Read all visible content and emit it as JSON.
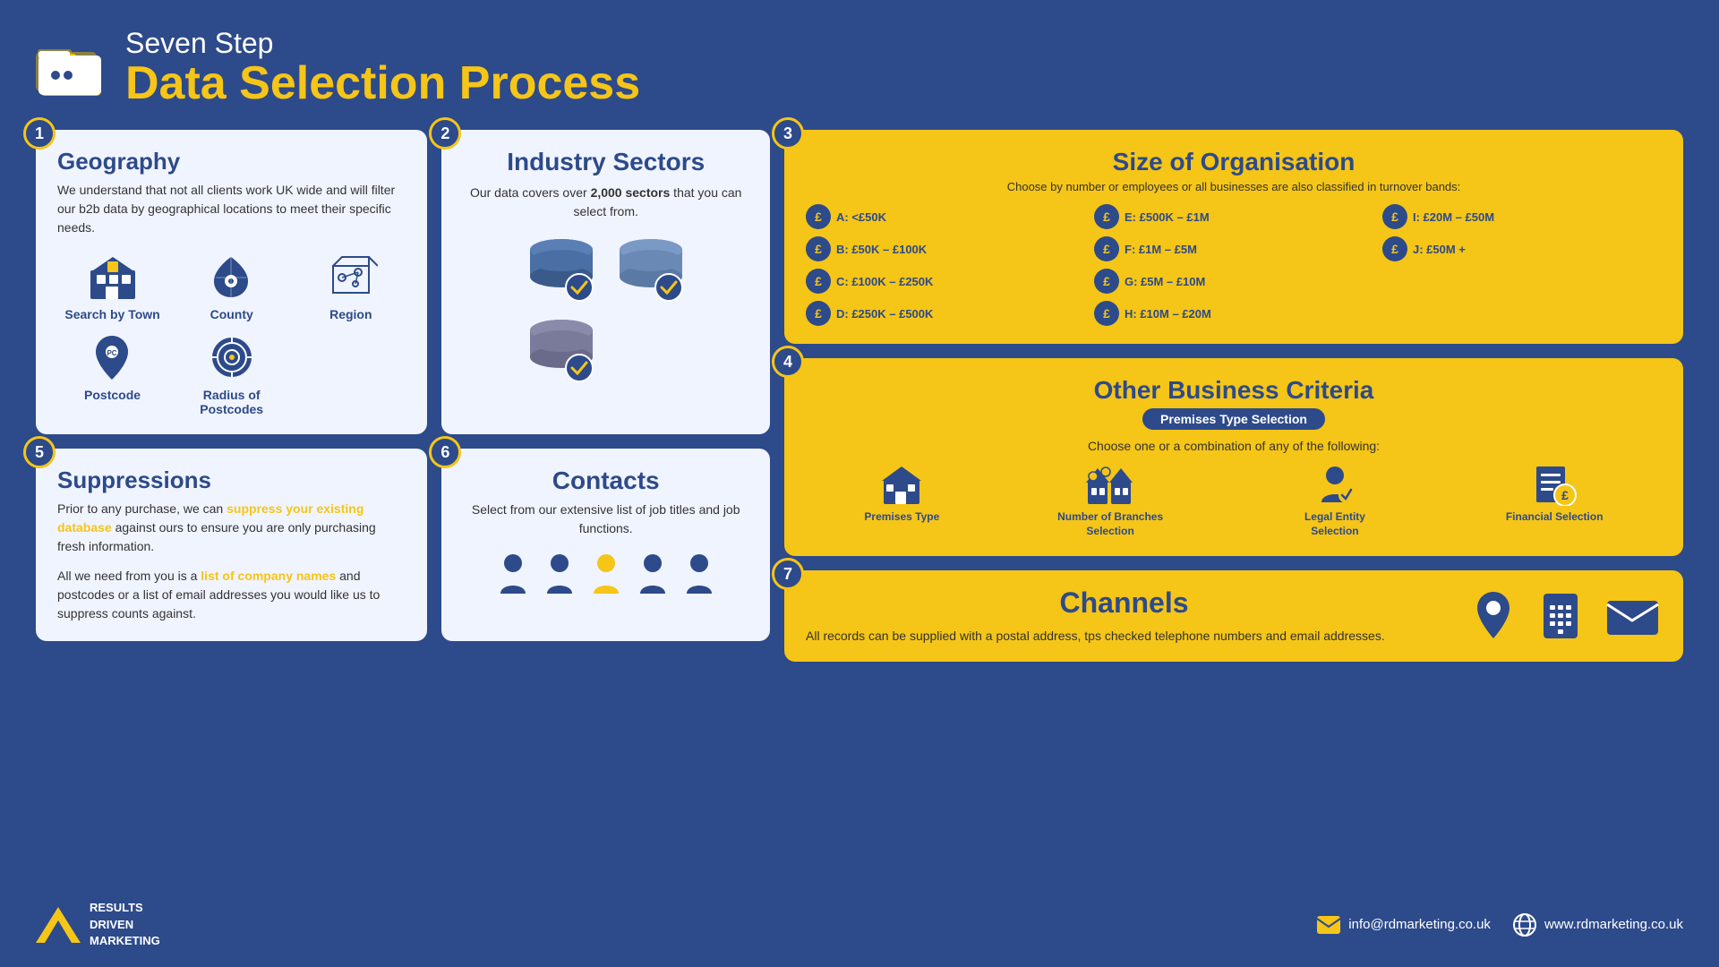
{
  "header": {
    "subtitle": "Seven Step",
    "title": "Data Selection Process"
  },
  "steps": {
    "step1": {
      "number": "1",
      "title": "Geography",
      "description": "We understand that not all clients work UK wide and will filter our b2b data by geographical locations to meet their specific needs.",
      "icons": [
        {
          "label": "Search by Town"
        },
        {
          "label": "County"
        },
        {
          "label": "Region"
        },
        {
          "label": "Postcode"
        },
        {
          "label": "Radius of Postcodes"
        }
      ]
    },
    "step2": {
      "number": "2",
      "title": "Industry Sectors",
      "description": "Our data covers over ",
      "highlight": "2,000 sectors",
      "description2": " that you can select from."
    },
    "step3": {
      "number": "3",
      "title": "Size of Organisation",
      "subtitle": "Choose by number or employees or all businesses are also classified in turnover bands:",
      "bands": [
        {
          "label": "A: <£50K"
        },
        {
          "label": "E: £500K – £1M"
        },
        {
          "label": "I: £20M – £50M"
        },
        {
          "label": "B: £50K – £100K"
        },
        {
          "label": "F: £1M – £5M"
        },
        {
          "label": "J: £50M +"
        },
        {
          "label": "C: £100K – £250K"
        },
        {
          "label": "G: £5M – £10M"
        },
        {
          "label": ""
        },
        {
          "label": "D: £250K – £500K"
        },
        {
          "label": "H: £10M – £20M"
        },
        {
          "label": ""
        }
      ]
    },
    "step4": {
      "number": "4",
      "title": "Other Business Criteria",
      "badge": "Premises Type Selection",
      "subtitle": "Choose one or a combination of any of the following:",
      "items": [
        {
          "label": "Premises Type"
        },
        {
          "label": "Number of Branches Selection"
        },
        {
          "label": "Legal Entity Selection"
        },
        {
          "label": "Financial Selection"
        }
      ]
    },
    "step5": {
      "number": "5",
      "title": "Suppressions",
      "text1": "Prior to any purchase, we can ",
      "highlight1": "suppress your existing database",
      "text2": " against ours to ensure you are only purchasing fresh information.",
      "text3": "All we need from you is a ",
      "highlight2": "list of company names",
      "text4": " and postcodes or a list of email addresses you would like us to suppress counts against."
    },
    "step6": {
      "number": "6",
      "title": "Contacts",
      "description": "Select from our extensive list of job titles and job functions."
    },
    "step7": {
      "number": "7",
      "title": "Channels",
      "description": "All records can be supplied with a postal address, tps checked telephone numbers and email addresses."
    }
  },
  "footer": {
    "logo_lines": [
      "RESULTS",
      "DRIVEN",
      "MARKETING"
    ],
    "email": "info@rdmarketing.co.uk",
    "website": "www.rdmarketing.co.uk"
  }
}
